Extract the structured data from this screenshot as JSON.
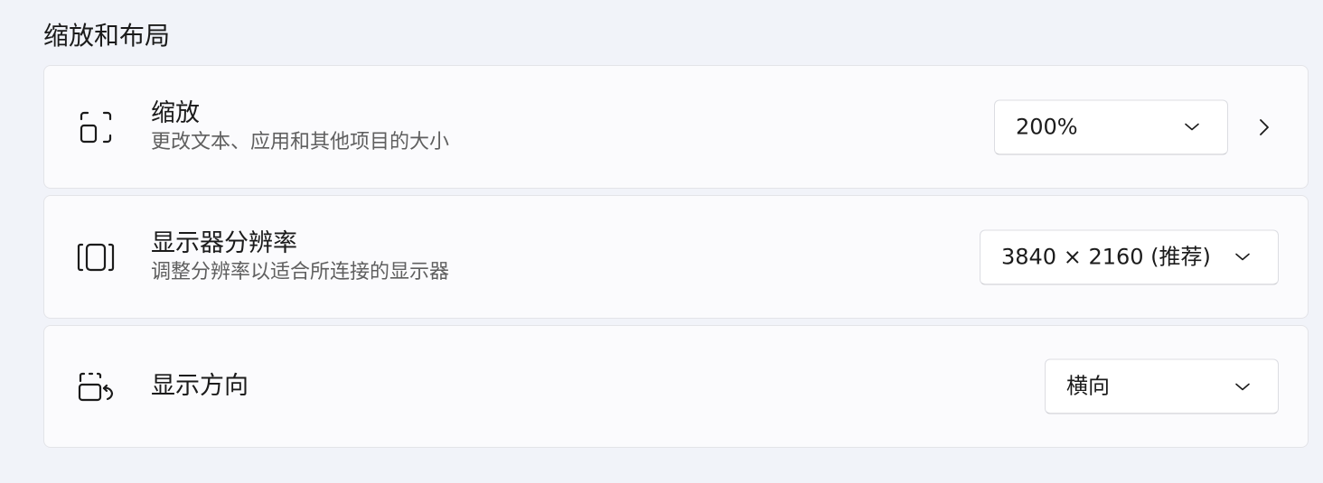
{
  "section": {
    "title": "缩放和布局"
  },
  "rows": [
    {
      "icon": "scale-icon",
      "title": "缩放",
      "description": "更改文本、应用和其他项目的大小",
      "dropdown_value": "200%",
      "has_expand": true
    },
    {
      "icon": "resolution-icon",
      "title": "显示器分辨率",
      "description": "调整分辨率以适合所连接的显示器",
      "dropdown_value": "3840 × 2160 (推荐)"
    },
    {
      "icon": "orientation-icon",
      "title": "显示方向",
      "dropdown_value": "横向"
    }
  ],
  "colors": {
    "page_background": "#f1f3f9",
    "card_background": "#fbfbfd",
    "card_border": "#e3e4e8",
    "primary_text": "#1b1b1b",
    "secondary_text": "#5f5f5f"
  }
}
